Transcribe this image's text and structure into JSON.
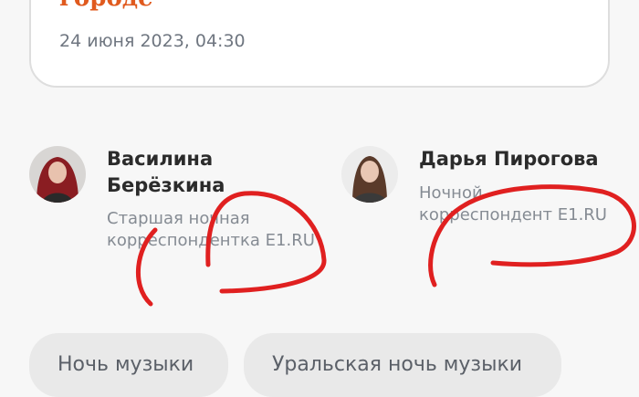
{
  "article_card": {
    "title_fragment": "городе",
    "date": "24 июня 2023, 04:30"
  },
  "authors": [
    {
      "name": "Василина Берёзкина",
      "role": "Старшая ночная корреспондентка E1.RU"
    },
    {
      "name": "Дарья Пирогова",
      "role": "Ночной корреспондент E1.RU"
    }
  ],
  "tags": [
    "Ночь музыки",
    "Уральская ночь музыки"
  ],
  "colors": {
    "accent": "#e05a1e",
    "annotation": "#e02020"
  }
}
